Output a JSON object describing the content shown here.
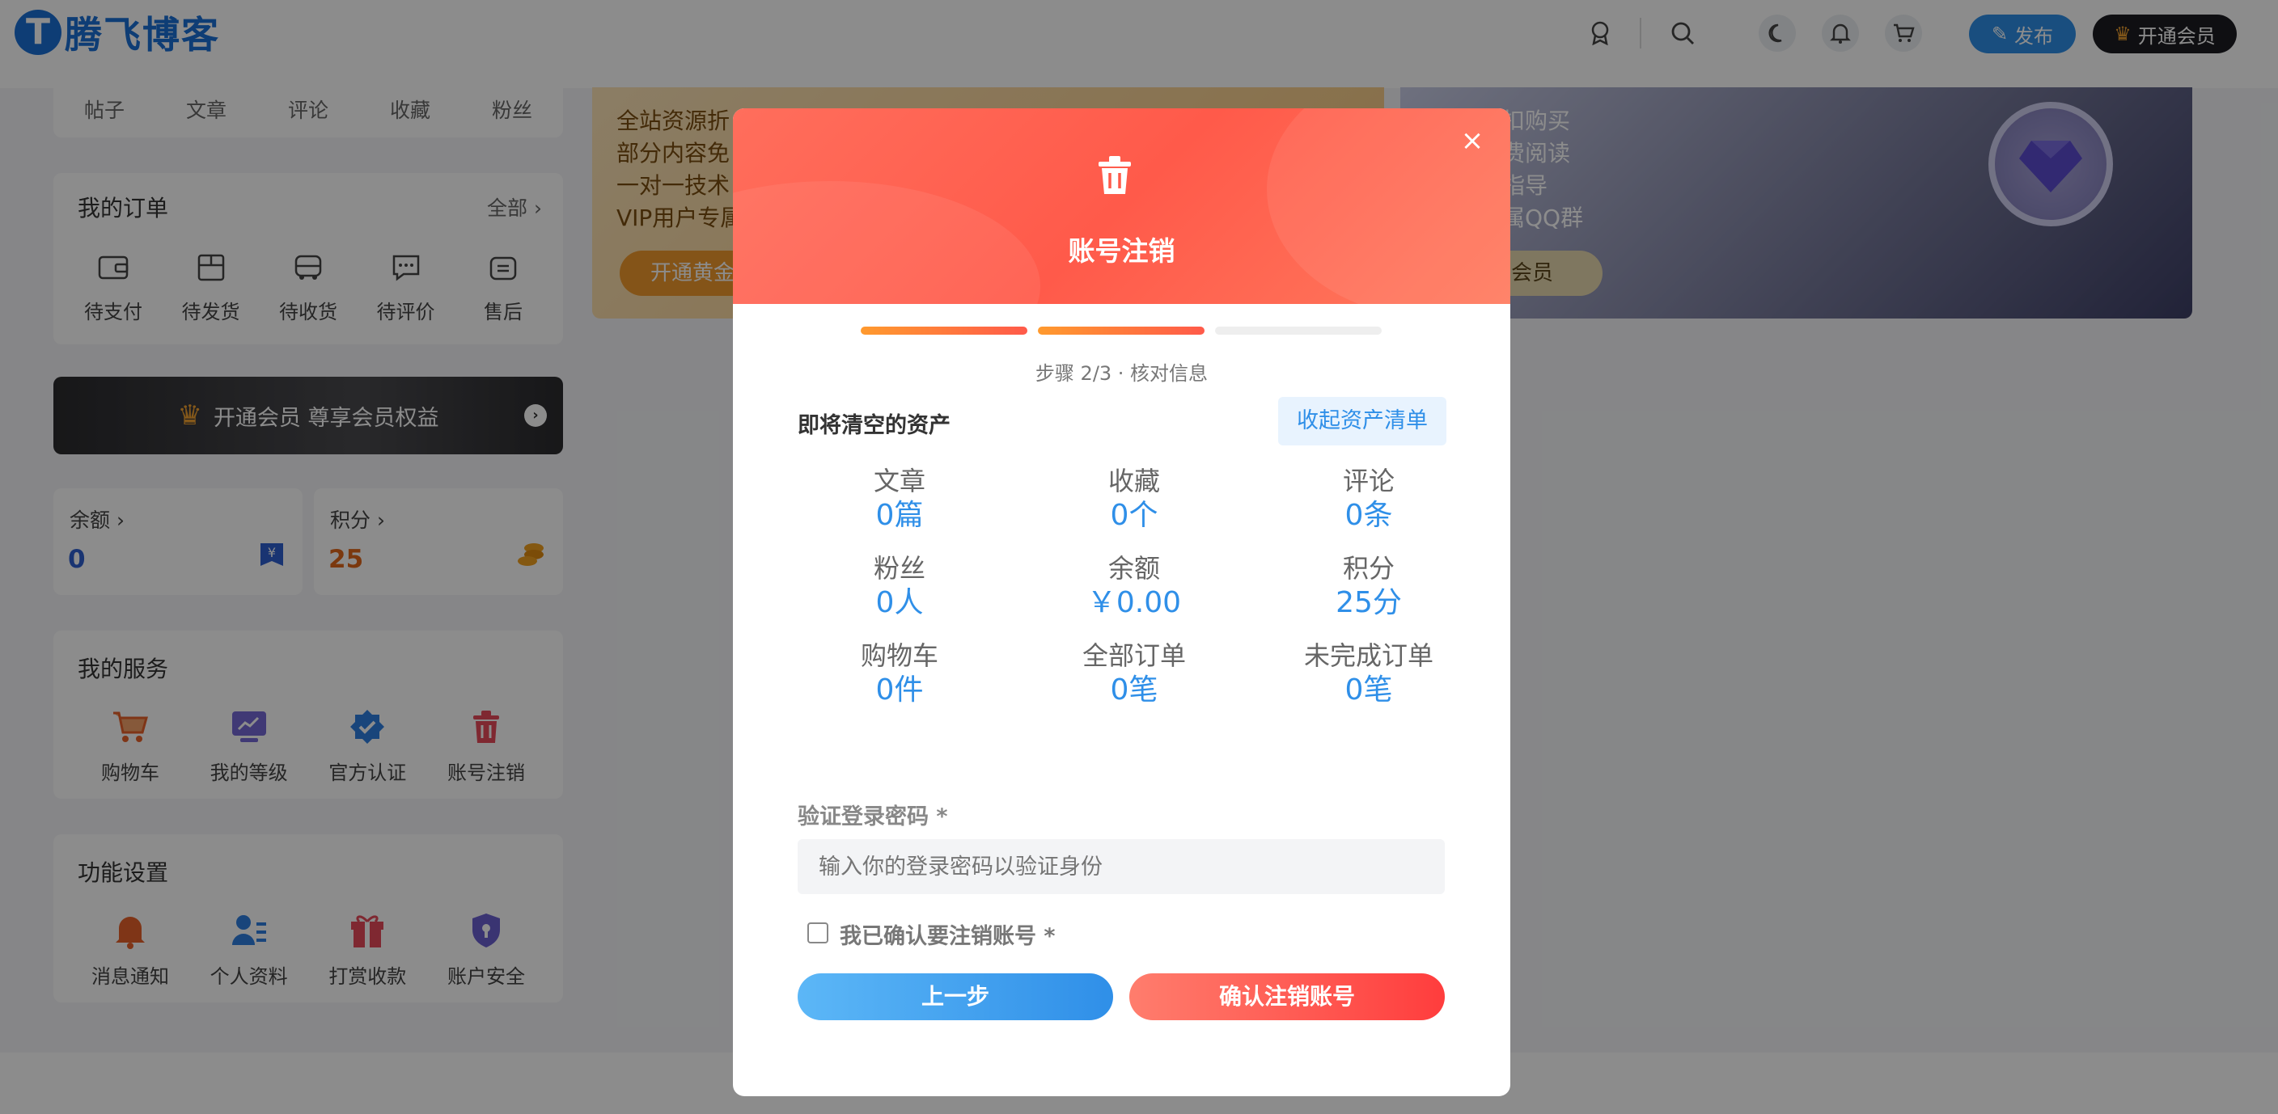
{
  "header": {
    "logo_mark": "T",
    "logo_text": "腾飞博客",
    "post_label": "发布",
    "vip_label": "开通会员",
    "icons": [
      "award-icon",
      "search-icon",
      "moon-icon",
      "bell-icon",
      "cart-icon"
    ]
  },
  "profile_tabs": [
    "帖子",
    "文章",
    "评论",
    "收藏",
    "粉丝"
  ],
  "orders": {
    "title": "我的订单",
    "more": "全部",
    "items": [
      {
        "label": "待支付",
        "icon": "wallet-icon"
      },
      {
        "label": "待发货",
        "icon": "package-icon"
      },
      {
        "label": "待收货",
        "icon": "truck-icon"
      },
      {
        "label": "待评价",
        "icon": "comment-icon"
      },
      {
        "label": "售后",
        "icon": "refund-icon"
      }
    ]
  },
  "vip_bar": {
    "label": "开通会员 尊享会员权益"
  },
  "balance": {
    "label": "余额",
    "value": "0"
  },
  "points": {
    "label": "积分",
    "value": "25"
  },
  "services": {
    "title": "我的服务",
    "items": [
      {
        "label": "购物车",
        "icon": "cart-icon"
      },
      {
        "label": "我的等级",
        "icon": "level-icon"
      },
      {
        "label": "官方认证",
        "icon": "verified-icon"
      },
      {
        "label": "账号注销",
        "icon": "trash-icon"
      }
    ]
  },
  "settings": {
    "title": "功能设置",
    "items": [
      {
        "label": "消息通知",
        "icon": "bell-icon"
      },
      {
        "label": "个人资料",
        "icon": "profile-icon"
      },
      {
        "label": "打赏收款",
        "icon": "gift-icon"
      },
      {
        "label": "账户安全",
        "icon": "shield-icon"
      }
    ]
  },
  "banner_gold": {
    "lines": [
      "全站资源折",
      "部分内容免",
      "一对一技术",
      "VIP用户专属"
    ],
    "button": "开通黄金"
  },
  "banner_diamond": {
    "lines": [
      "源折扣购买",
      "容免费阅读",
      "技术指导",
      "户专属QQ群"
    ],
    "button": "石会员"
  },
  "modal": {
    "title": "账号注销",
    "close": "×",
    "step_text": "步骤 2/3 · 核对信息",
    "section_title": "即将清空的资产",
    "collapse_label": "收起资产清单",
    "stats": [
      {
        "key": "文章",
        "value": "0篇"
      },
      {
        "key": "收藏",
        "value": "0个"
      },
      {
        "key": "评论",
        "value": "0条"
      },
      {
        "key": "粉丝",
        "value": "0人"
      },
      {
        "key": "余额",
        "value": "￥0.00"
      },
      {
        "key": "积分",
        "value": "25分"
      },
      {
        "key": "购物车",
        "value": "0件"
      },
      {
        "key": "全部订单",
        "value": "0笔"
      },
      {
        "key": "未完成订单",
        "value": "0笔"
      }
    ],
    "password_label": "验证登录密码 *",
    "password_placeholder": "输入你的登录密码以验证身份",
    "password_value": "",
    "confirm_label": "我已确认要注销账号 *",
    "confirm_checked": false,
    "prev_label": "上一步",
    "confirm_button": "确认注销账号",
    "progress_colors": [
      "#ff8a3d",
      "#ff8a3d",
      "#eeeeee"
    ]
  }
}
